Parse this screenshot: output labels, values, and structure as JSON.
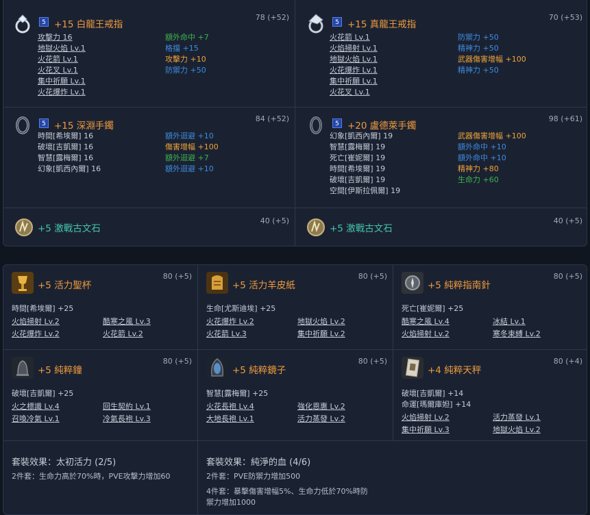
{
  "top_panel": {
    "items": [
      {
        "name": "+15 白龍王戒指",
        "level": "5",
        "score": "78 (+52)",
        "icon": "ring-icon",
        "stats": [
          [
            "攻擊力 16",
            "g"
          ],
          [
            "地獄火焰 Lv.1",
            "u"
          ],
          [
            "火花箭 Lv.1",
            "u"
          ],
          [
            "火花叉 Lv.1",
            "u"
          ],
          [
            "集中祈願 Lv.1",
            "u"
          ],
          [
            "火花爆炸 Lv.1",
            "u"
          ]
        ],
        "bonus": [
          [
            "額外命中 +7",
            "green"
          ],
          [
            "格擋 +15",
            "blue"
          ],
          [
            "攻擊力 +10",
            "orange"
          ],
          [
            "防禦力 +50",
            "blue"
          ]
        ]
      },
      {
        "name": "+15 真龍王戒指",
        "level": "5",
        "score": "70 (+53)",
        "icon": "dragon-ring-icon",
        "stats": [
          [
            "火花箭 Lv.1",
            "u"
          ],
          [
            "火焰掃射 Lv.1",
            "u"
          ],
          [
            "地獄火焰 Lv.1",
            "u"
          ],
          [
            "火花爆炸 Lv.1",
            "u"
          ],
          [
            "集中祈願 Lv.1",
            "u"
          ],
          [
            "火花叉 Lv.1",
            "u"
          ]
        ],
        "bonus": [
          [
            "防禦力 +50",
            "blue"
          ],
          [
            "精神力 +50",
            "blue"
          ],
          [
            "武器傷害增幅 +100",
            "orange"
          ],
          [
            "精神力 +50",
            "blue"
          ]
        ]
      },
      {
        "name": "+15 深淵手鐲",
        "level": "5",
        "score": "84 (+52)",
        "icon": "bracelet-icon",
        "stats": [
          [
            "時間[希埃爾] 16",
            "g"
          ],
          [
            "破壞[吉凱爾] 16",
            "g"
          ],
          [
            "智慧[露梅爾] 16",
            "g"
          ],
          [
            "幻象[凱西內爾] 16",
            "g"
          ]
        ],
        "bonus": [
          [
            "額外迴避 +10",
            "blue"
          ],
          [
            "傷害增幅 +100",
            "orange"
          ],
          [
            "額外迴避 +7",
            "green"
          ],
          [
            "額外迴避 +10",
            "blue"
          ]
        ]
      },
      {
        "name": "+20 盧德萊手鐲",
        "level": "5",
        "score": "98 (+61)",
        "icon": "bracelet-icon",
        "stats": [
          [
            "幻象[凱西內爾] 19",
            "g"
          ],
          [
            "智慧[露梅爾] 19",
            "g"
          ],
          [
            "死亡[崔妮爾] 19",
            "g"
          ],
          [
            "時間[希埃爾] 19",
            "g"
          ],
          [
            "破壞[吉凱爾] 19",
            "g"
          ],
          [
            "空間[伊斯拉佩爾] 19",
            "g"
          ]
        ],
        "bonus": [
          [
            "武器傷害增幅 +100",
            "orange"
          ],
          [
            "額外命中 +10",
            "blue"
          ],
          [
            "額外命中 +10",
            "blue"
          ],
          [
            "精神力 +80",
            "orange"
          ],
          [
            "生命力 +60",
            "green"
          ]
        ]
      },
      {
        "name": "+5 激戰古文石",
        "score": "40 (+5)",
        "icon": "rune-stone-icon"
      },
      {
        "name": "+5 激戰古文石",
        "score": "40 (+5)",
        "icon": "rune-stone-icon"
      }
    ]
  },
  "bottom_panel": {
    "items": [
      {
        "name": "+5 活力聖杯",
        "score": "80 (+5)",
        "icon": "chalice-icon",
        "main": "時間[希埃爾] +25",
        "skills": [
          "火焰掃射 Lv.2",
          "酷寒之風 Lv.3",
          "火花爆炸 Lv.2",
          "火花箭 Lv.2"
        ]
      },
      {
        "name": "+5 活力羊皮紙",
        "score": "80 (+5)",
        "icon": "parchment-icon",
        "main": "生命[尤斯迪埃] +25",
        "skills": [
          "火花爆炸 Lv.2",
          "地獄火焰 Lv.2",
          "火花箭 Lv.3",
          "集中祈願 Lv.2"
        ]
      },
      {
        "name": "+5 純粹指南針",
        "score": "80 (+5)",
        "icon": "compass-icon",
        "main": "死亡[崔妮爾] +25",
        "skills": [
          "酷寒之風 Lv.4",
          "冰結 Lv.1",
          "火焰掃射 Lv.2",
          "寒冬束縛 Lv.2"
        ]
      },
      {
        "name": "+5 純粹鐘",
        "score": "80 (+5)",
        "icon": "bell-icon",
        "main": "破壞[吉凱爾] +25",
        "skills": [
          "火之標識 Lv.4",
          "回生契約 Lv.1",
          "召喚冷氣 Lv.1",
          "冷氣長袍 Lv.3"
        ]
      },
      {
        "name": "+5 純粹鏡子",
        "score": "80 (+5)",
        "icon": "mirror-icon",
        "main": "智慧[露梅爾] +25",
        "skills": [
          "火花長袍 Lv.4",
          "強化恩惠 Lv.2",
          "大地長袍 Lv.1",
          "活力蒸發 Lv.2"
        ]
      },
      {
        "name": "+4 純粹天秤",
        "score": "80 (+4)",
        "icon": "scales-icon",
        "main": "破壞[吉凱爾] +14",
        "main2": "命運[瑪爾庫妲] +14",
        "skills": [
          "火焰掃射 Lv.2",
          "活力蒸發 Lv.1",
          "集中祈願 Lv.3",
          "地獄火焰 Lv.2"
        ]
      }
    ],
    "sets": [
      {
        "title": "套裝效果：太初活力 (2/5)",
        "lines": [
          "2件套：生命力高於70%時，PVE攻擊力增加60"
        ]
      },
      {
        "title": "套裝效果：純淨的血 (4/6)",
        "lines": [
          "2件套：PVE防禦力增加500",
          "4件套：暴擊傷害增幅5%、生命力低於70%時防",
          "禦力增加1000"
        ]
      }
    ]
  },
  "colors": {
    "name": "#f09a3c",
    "green": "#3fb34f",
    "blue": "#3f8be0",
    "orange": "#f0a338",
    "teal": "#45c6a8"
  }
}
